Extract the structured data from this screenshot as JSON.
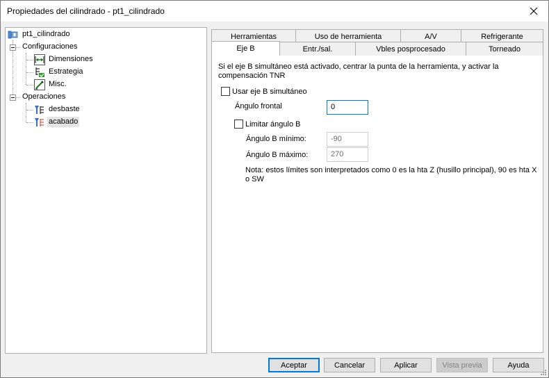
{
  "window": {
    "title": "Propiedades del cilindrado - pt1_cilindrado"
  },
  "tree": {
    "root": "pt1_cilindrado",
    "configuraciones": {
      "label": "Configuraciones",
      "items": [
        "Dimensiones",
        "Estrategia",
        "Misc."
      ]
    },
    "operaciones": {
      "label": "Operaciones",
      "items": [
        "desbaste",
        "acabado"
      ],
      "selected": "acabado"
    }
  },
  "tabs": {
    "row1": [
      "Herramientas",
      "Uso de herramienta",
      "A/V",
      "Refrigerante"
    ],
    "row2": [
      "Eje B",
      "Entr./sal.",
      "Vbles posprocesado",
      "Torneado"
    ],
    "active": "Eje B"
  },
  "ejeb": {
    "description_line1": "Si el eje B simultáneo está activado, centrar la punta de la herramienta, y activar la",
    "description_line2": "compensación TNR",
    "usar_label": "Usar eje B simultáneo",
    "angulo_frontal_label": "Ángulo frontal",
    "angulo_frontal_value": "0",
    "limitar_label": "Limitar ángulo B",
    "min_label": "Ángulo B mínimo:",
    "min_value": "-90",
    "max_label": "Ángulo B máximo:",
    "max_value": "270",
    "nota_line1": "Nota: estos límites son interpretados como 0 es la hta Z (husillo principal), 90 es hta X",
    "nota_line2": "o SW"
  },
  "buttons": {
    "aceptar": "Aceptar",
    "cancelar": "Cancelar",
    "aplicar": "Aplicar",
    "vista_previa": "Vista previa",
    "ayuda": "Ayuda"
  },
  "icons": {
    "close": "close-icon",
    "part": "part-icon",
    "dimensiones": "dimensions-icon",
    "estrategia": "strategy-icon",
    "misc": "misc-icon",
    "desbaste": "roughing-op-icon",
    "acabado": "finishing-op-icon"
  },
  "colors": {
    "accent": "#0078d7",
    "selection": "#e5e5e5"
  }
}
